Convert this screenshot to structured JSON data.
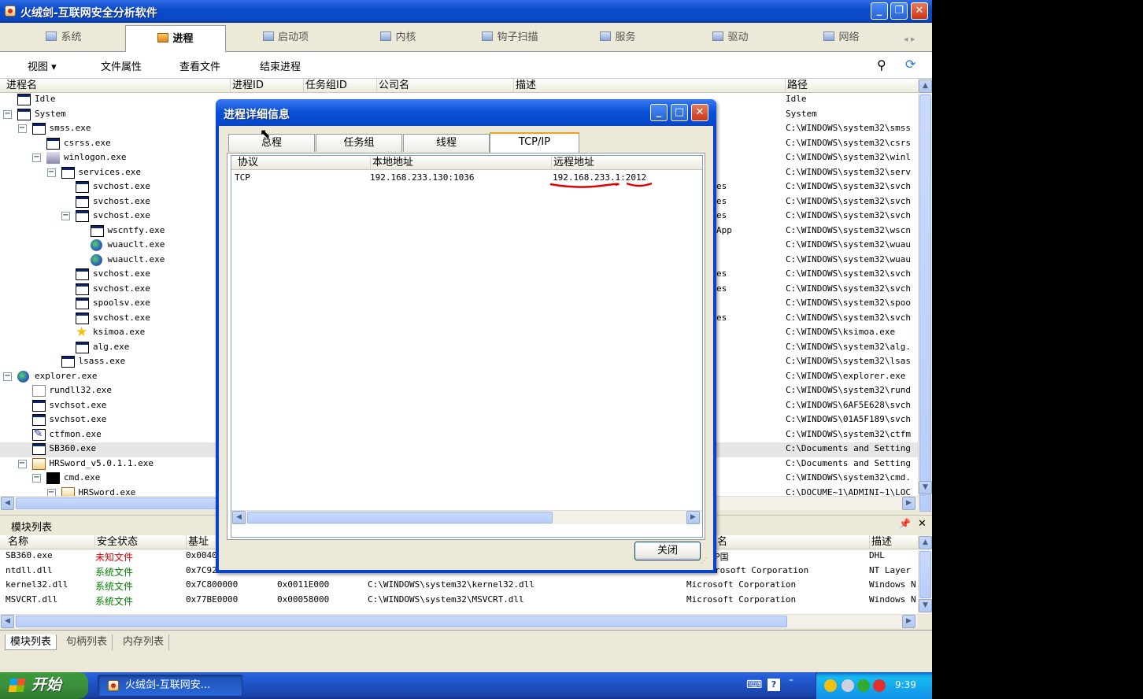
{
  "window": {
    "title": "火绒剑-互联网安全分析软件"
  },
  "main_tabs": [
    "系统",
    "进程",
    "启动项",
    "内核",
    "钩子扫描",
    "服务",
    "驱动",
    "网络"
  ],
  "active_tab_index": 1,
  "toolbar": {
    "view": "视图 ▾",
    "file_props": "文件属性",
    "view_file": "查看文件",
    "end_process": "结束进程"
  },
  "process_headers": {
    "name": "进程名",
    "pid": "进程ID",
    "taskgroup": "任务组ID",
    "company": "公司名",
    "desc": "描述",
    "path": "路径"
  },
  "processes": [
    {
      "name": "Idle",
      "path": "Idle",
      "desc": ""
    },
    {
      "name": "System",
      "path": "System",
      "desc": ""
    },
    {
      "name": "smss.exe",
      "path": "C:\\WINDOWS\\system32\\smss",
      "desc": ""
    },
    {
      "name": "csrss.exe",
      "path": "C:\\WINDOWS\\system32\\csrs",
      "desc": ""
    },
    {
      "name": "winlogon.exe",
      "path": "C:\\WINDOWS\\system32\\winl",
      "desc": ""
    },
    {
      "name": "services.exe",
      "path": "C:\\WINDOWS\\system32\\serv",
      "desc": ""
    },
    {
      "name": "svchost.exe",
      "path": "C:\\WINDOWS\\system32\\svch",
      "desc": "es"
    },
    {
      "name": "svchost.exe",
      "path": "C:\\WINDOWS\\system32\\svch",
      "desc": "es"
    },
    {
      "name": "svchost.exe",
      "path": "C:\\WINDOWS\\system32\\svch",
      "desc": "es"
    },
    {
      "name": "wscntfy.exe",
      "path": "C:\\WINDOWS\\system32\\wscn",
      "desc": "App"
    },
    {
      "name": "wuauclt.exe",
      "path": "C:\\WINDOWS\\system32\\wuau",
      "desc": ""
    },
    {
      "name": "wuauclt.exe",
      "path": "C:\\WINDOWS\\system32\\wuau",
      "desc": ""
    },
    {
      "name": "svchost.exe",
      "path": "C:\\WINDOWS\\system32\\svch",
      "desc": "es"
    },
    {
      "name": "svchost.exe",
      "path": "C:\\WINDOWS\\system32\\svch",
      "desc": "es"
    },
    {
      "name": "spoolsv.exe",
      "path": "C:\\WINDOWS\\system32\\spoo",
      "desc": ""
    },
    {
      "name": "svchost.exe",
      "path": "C:\\WINDOWS\\system32\\svch",
      "desc": "es"
    },
    {
      "name": "ksimoa.exe",
      "path": "C:\\WINDOWS\\ksimoa.exe",
      "desc": ""
    },
    {
      "name": "alg.exe",
      "path": "C:\\WINDOWS\\system32\\alg.",
      "desc": ""
    },
    {
      "name": "lsass.exe",
      "path": "C:\\WINDOWS\\system32\\lsas",
      "desc": ""
    },
    {
      "name": "explorer.exe",
      "path": "C:\\WINDOWS\\explorer.exe",
      "desc": ""
    },
    {
      "name": "rundll32.exe",
      "path": "C:\\WINDOWS\\system32\\rund",
      "desc": ""
    },
    {
      "name": "svchsot.exe",
      "path": "C:\\WINDOWS\\6AF5E628\\svch",
      "desc": ""
    },
    {
      "name": "svchsot.exe",
      "path": "C:\\WINDOWS\\01A5F189\\svch",
      "desc": ""
    },
    {
      "name": "ctfmon.exe",
      "path": "C:\\WINDOWS\\system32\\ctfm",
      "desc": ""
    },
    {
      "name": "SB360.exe",
      "path": "C:\\Documents and Setting",
      "desc": ""
    },
    {
      "name": "HRSword_v5.0.1.1.exe",
      "path": "C:\\Documents and Setting",
      "desc": ""
    },
    {
      "name": "cmd.exe",
      "path": "C:\\WINDOWS\\system32\\cmd.",
      "desc": ""
    },
    {
      "name": "HRSword.exe",
      "path": "C:\\DOCUME~1\\ADMINI~1\\LOC",
      "desc": ""
    }
  ],
  "module_panel": {
    "title": "模块列表",
    "pin": "📌",
    "close": "✕"
  },
  "module_headers": {
    "name": "名称",
    "status": "安全状态",
    "base": "基址",
    "sign": "名",
    "desc": "描述"
  },
  "modules": [
    {
      "name": "SB360.exe",
      "status": "未知文件",
      "base": "0x0040",
      "size": "",
      "path": "",
      "sign": "P国",
      "desc": "DHL"
    },
    {
      "name": "ntdll.dll",
      "status": "系统文件",
      "base": "0x7C92",
      "size": "",
      "path": "",
      "sign": "rosoft Corporation",
      "desc": "NT Layer"
    },
    {
      "name": "kernel32.dll",
      "status": "系统文件",
      "base": "0x7C800000",
      "size": "0x0011E000",
      "path": "C:\\WINDOWS\\system32\\kernel32.dll",
      "sign": "Microsoft Corporation",
      "desc": "Windows N"
    },
    {
      "name": "MSVCRT.dll",
      "status": "系统文件",
      "base": "0x77BE0000",
      "size": "0x00058000",
      "path": "C:\\WINDOWS\\system32\\MSVCRT.dll",
      "sign": "Microsoft Corporation",
      "desc": "Windows N"
    }
  ],
  "bottom_tabs": [
    "模块列表",
    "句柄列表",
    "内存列表"
  ],
  "dialog": {
    "title": "进程详细信息",
    "tabs": [
      "总程",
      "任务组",
      "线程",
      "TCP/IP"
    ],
    "active_tab": 3,
    "columns": {
      "proto": "协议",
      "local": "本地地址",
      "remote": "远程地址"
    },
    "connections": [
      {
        "proto": "TCP",
        "local": "192.168.233.130:1036",
        "remote": "192.168.233.1:2012"
      }
    ],
    "close_label": "关闭"
  },
  "taskbar": {
    "start": "开始",
    "item": "火绒剑-互联网安...",
    "clock": "9:39"
  },
  "colors": {
    "unknown_file": "#e00000",
    "system_file": "#008000",
    "annotation": "#e00000",
    "xp_blue": "#0a48c4"
  }
}
